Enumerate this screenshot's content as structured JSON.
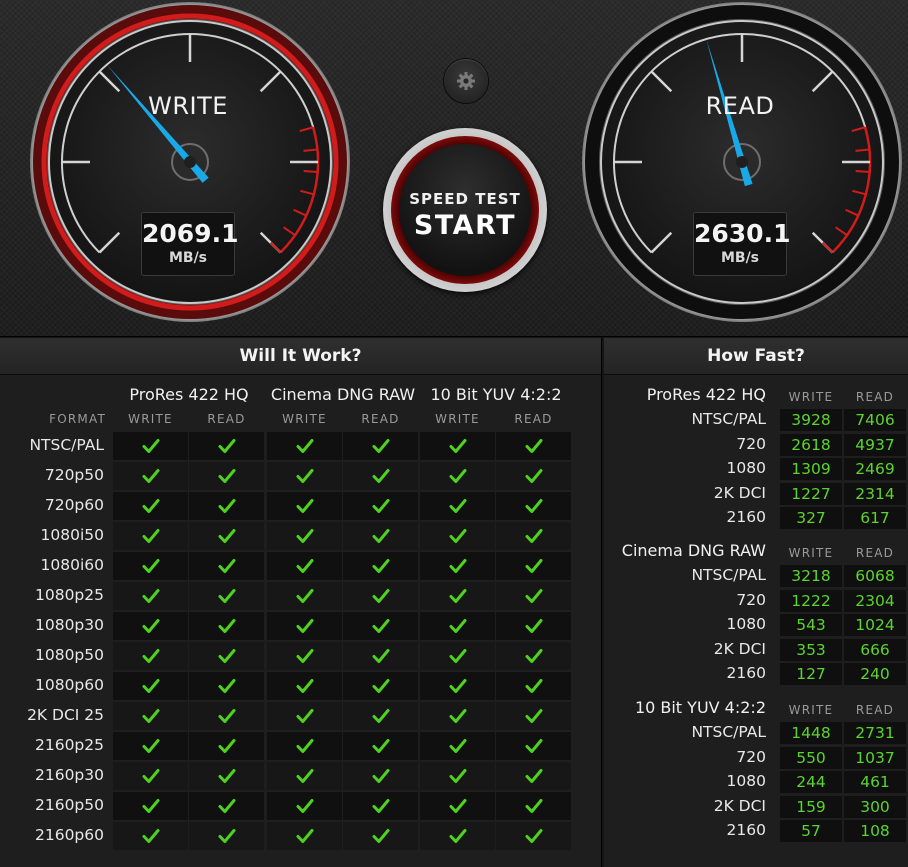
{
  "gauges": {
    "write": {
      "title": "WRITE",
      "value": "2069.1",
      "unit": "MB/s",
      "needle_fraction": 0.35
    },
    "read": {
      "title": "READ",
      "value": "2630.1",
      "unit": "MB/s",
      "needle_fraction": 0.44
    }
  },
  "controls": {
    "settings_icon": "gear-icon",
    "start_line1": "SPEED TEST",
    "start_line2": "START"
  },
  "colors": {
    "accent_red": "#d21c1c",
    "needle_blue": "#1aa9e8",
    "value_green": "#5bd42e",
    "check_green": "#4fd11f"
  },
  "will_it_work": {
    "title": "Will It Work?",
    "format_label": "FORMAT",
    "groups": [
      {
        "name": "ProRes 422 HQ",
        "write_label": "WRITE",
        "read_label": "READ"
      },
      {
        "name": "Cinema DNG RAW",
        "write_label": "WRITE",
        "read_label": "READ"
      },
      {
        "name": "10 Bit YUV 4:2:2",
        "write_label": "WRITE",
        "read_label": "READ"
      }
    ],
    "check_icon": "check-icon",
    "rows": [
      {
        "format": "NTSC/PAL",
        "cells": [
          true,
          true,
          true,
          true,
          true,
          true
        ]
      },
      {
        "format": "720p50",
        "cells": [
          true,
          true,
          true,
          true,
          true,
          true
        ]
      },
      {
        "format": "720p60",
        "cells": [
          true,
          true,
          true,
          true,
          true,
          true
        ]
      },
      {
        "format": "1080i50",
        "cells": [
          true,
          true,
          true,
          true,
          true,
          true
        ]
      },
      {
        "format": "1080i60",
        "cells": [
          true,
          true,
          true,
          true,
          true,
          true
        ]
      },
      {
        "format": "1080p25",
        "cells": [
          true,
          true,
          true,
          true,
          true,
          true
        ]
      },
      {
        "format": "1080p30",
        "cells": [
          true,
          true,
          true,
          true,
          true,
          true
        ]
      },
      {
        "format": "1080p50",
        "cells": [
          true,
          true,
          true,
          true,
          true,
          true
        ]
      },
      {
        "format": "1080p60",
        "cells": [
          true,
          true,
          true,
          true,
          true,
          true
        ]
      },
      {
        "format": "2K DCI 25",
        "cells": [
          true,
          true,
          true,
          true,
          true,
          true
        ]
      },
      {
        "format": "2160p25",
        "cells": [
          true,
          true,
          true,
          true,
          true,
          true
        ]
      },
      {
        "format": "2160p30",
        "cells": [
          true,
          true,
          true,
          true,
          true,
          true
        ]
      },
      {
        "format": "2160p50",
        "cells": [
          true,
          true,
          true,
          true,
          true,
          true
        ]
      },
      {
        "format": "2160p60",
        "cells": [
          true,
          true,
          true,
          true,
          true,
          true
        ]
      }
    ]
  },
  "how_fast": {
    "title": "How Fast?",
    "write_label": "WRITE",
    "read_label": "READ",
    "groups": [
      {
        "name": "ProRes 422 HQ",
        "rows": [
          {
            "format": "NTSC/PAL",
            "write": "3928",
            "read": "7406"
          },
          {
            "format": "720",
            "write": "2618",
            "read": "4937"
          },
          {
            "format": "1080",
            "write": "1309",
            "read": "2469"
          },
          {
            "format": "2K DCI",
            "write": "1227",
            "read": "2314"
          },
          {
            "format": "2160",
            "write": "327",
            "read": "617"
          }
        ]
      },
      {
        "name": "Cinema DNG RAW",
        "rows": [
          {
            "format": "NTSC/PAL",
            "write": "3218",
            "read": "6068"
          },
          {
            "format": "720",
            "write": "1222",
            "read": "2304"
          },
          {
            "format": "1080",
            "write": "543",
            "read": "1024"
          },
          {
            "format": "2K DCI",
            "write": "353",
            "read": "666"
          },
          {
            "format": "2160",
            "write": "127",
            "read": "240"
          }
        ]
      },
      {
        "name": "10 Bit YUV 4:2:2",
        "rows": [
          {
            "format": "NTSC/PAL",
            "write": "1448",
            "read": "2731"
          },
          {
            "format": "720",
            "write": "550",
            "read": "1037"
          },
          {
            "format": "1080",
            "write": "244",
            "read": "461"
          },
          {
            "format": "2K DCI",
            "write": "159",
            "read": "300"
          },
          {
            "format": "2160",
            "write": "57",
            "read": "108"
          }
        ]
      }
    ]
  }
}
